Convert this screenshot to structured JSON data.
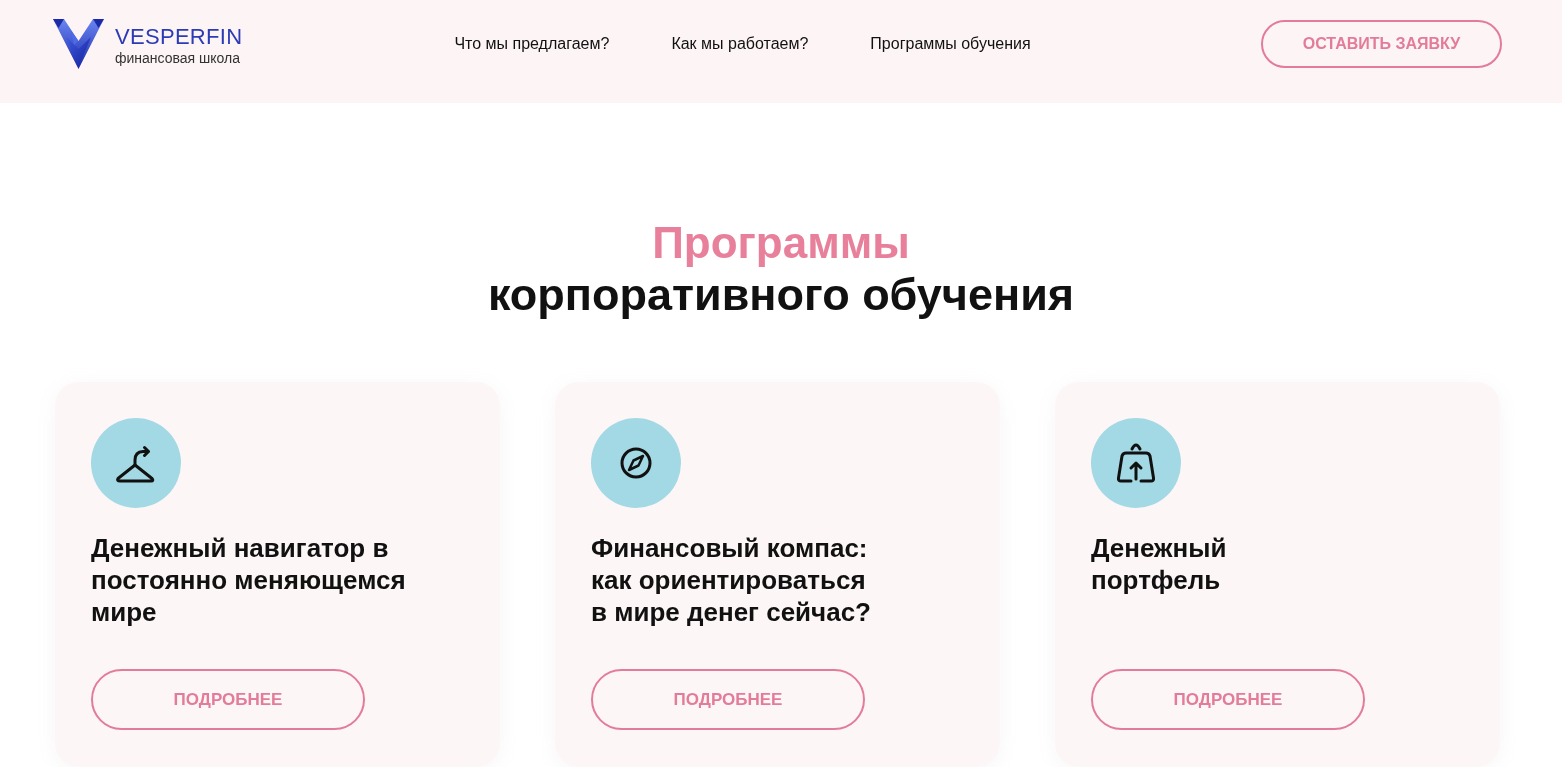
{
  "header": {
    "logo": {
      "name": "VESPERFIN",
      "tagline": "финансовая школа"
    },
    "nav": [
      "Что мы предлагаем?",
      "Как мы работаем?",
      "Программы обучения"
    ],
    "cta": "ОСТАВИТЬ ЗАЯВКУ"
  },
  "section": {
    "title_accent": "Программы",
    "title": "корпоративного обучения"
  },
  "cards": [
    {
      "title": "Денежный навигатор в\nпостоянно меняющемся\nмире",
      "button": "ПОДРОБНЕЕ"
    },
    {
      "title": "Финансовый компас:\nкак ориентироваться\nв мире денег сейчас?",
      "button": "ПОДРОБНЕЕ"
    },
    {
      "title": "Денежный\nпортфель",
      "button": "ПОДРОБНЕЕ"
    }
  ]
}
